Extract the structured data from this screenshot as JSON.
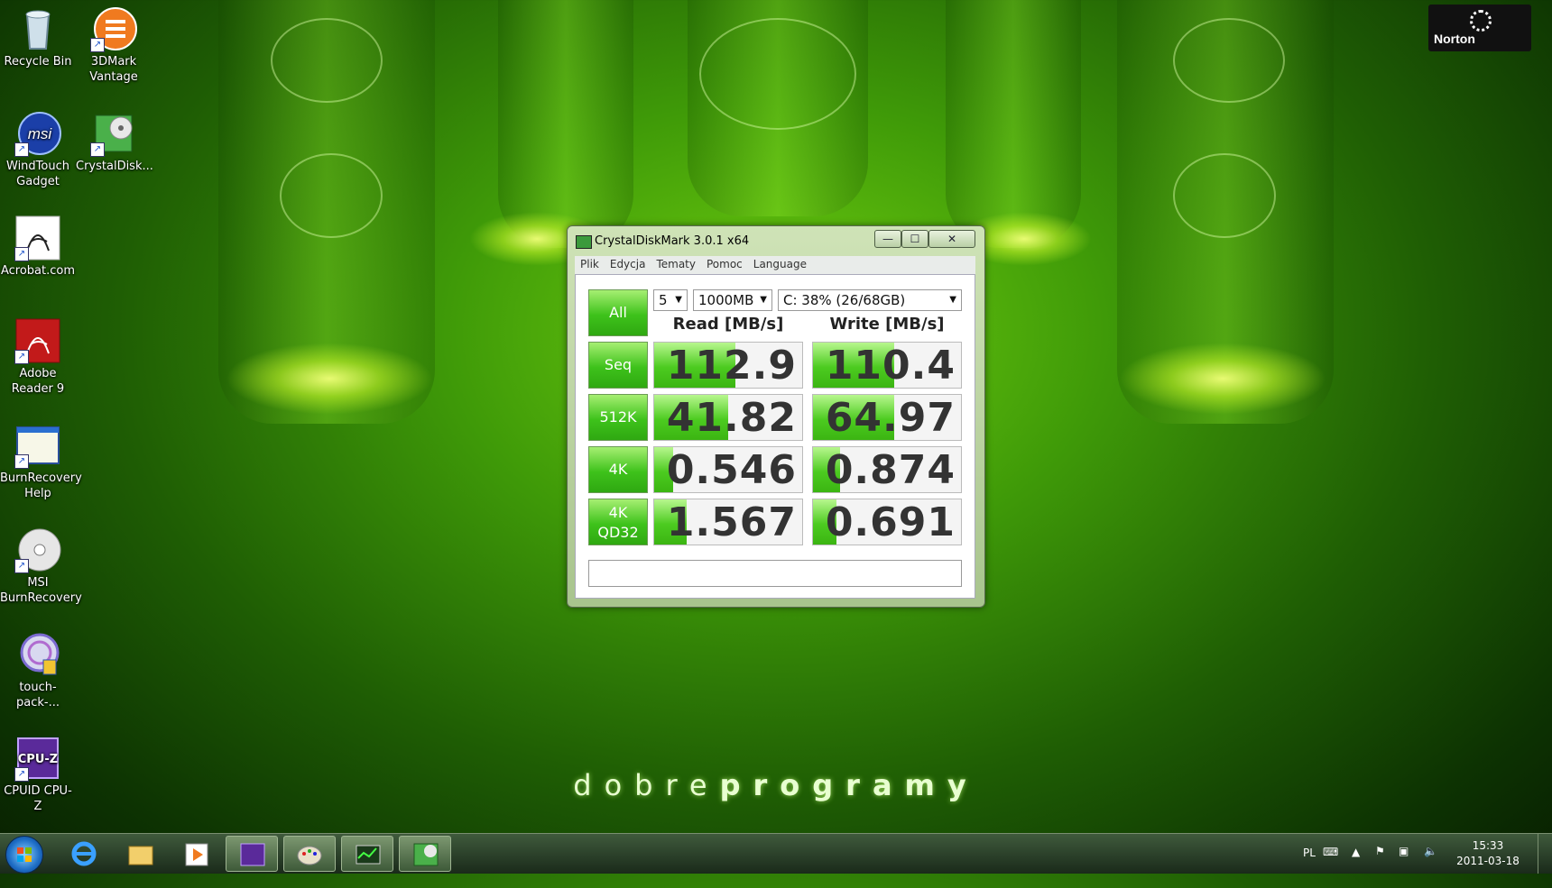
{
  "desktop": {
    "icons": [
      {
        "label": "Recycle Bin",
        "icon": "recycle-bin-icon"
      },
      {
        "label": "3DMark Vantage",
        "icon": "3dmark-icon"
      },
      {
        "label": "WindTouch Gadget",
        "icon": "msi-icon"
      },
      {
        "label": "CrystalDisk...",
        "icon": "crystaldisk-icon"
      },
      {
        "label": "Acrobat.com",
        "icon": "acrobat-icon"
      },
      {
        "label": "Adobe Reader 9",
        "icon": "adobe-reader-icon"
      },
      {
        "label": "BurnRecovery Help",
        "icon": "help-window-icon"
      },
      {
        "label": "MSI BurnRecovery",
        "icon": "disc-icon"
      },
      {
        "label": "touch-pack-...",
        "icon": "touch-pack-icon"
      },
      {
        "label": "CPUID CPU-Z",
        "icon": "cpuz-icon"
      }
    ],
    "norton_label": "Norton",
    "brand_light": "dobre",
    "brand_bold": "programy"
  },
  "window": {
    "title": "CrystalDiskMark 3.0.1 x64",
    "buttons": {
      "minimize": "—",
      "maximize": "☐",
      "close": "✕"
    },
    "menu": [
      "Plik",
      "Edycja",
      "Tematy",
      "Pomoc",
      "Language"
    ],
    "all_button": "All",
    "count_select": "5",
    "size_select": "1000MB",
    "drive_select": "C: 38% (26/68GB)",
    "read_header": "Read [MB/s]",
    "write_header": "Write [MB/s]",
    "rows": [
      {
        "label": "Seq",
        "read": "112.9",
        "write": "110.4",
        "read_fill": 0.55,
        "write_fill": 0.55
      },
      {
        "label": "512K",
        "read": "41.82",
        "write": "64.97",
        "read_fill": 0.5,
        "write_fill": 0.55
      },
      {
        "label": "4K",
        "read": "0.546",
        "write": "0.874",
        "read_fill": 0.13,
        "write_fill": 0.18
      },
      {
        "label_line1": "4K",
        "label_line2": "QD32",
        "read": "1.567",
        "write": "0.691",
        "read_fill": 0.22,
        "write_fill": 0.16
      }
    ],
    "comment": ""
  },
  "taskbar": {
    "apps": [
      "Internet Explorer",
      "Windows Explorer",
      "Media Player",
      "CPU-Z",
      "Paint",
      "Task Manager",
      "CrystalDiskMark"
    ],
    "language": "PL",
    "time": "15:33",
    "date": "2011-03-18"
  }
}
